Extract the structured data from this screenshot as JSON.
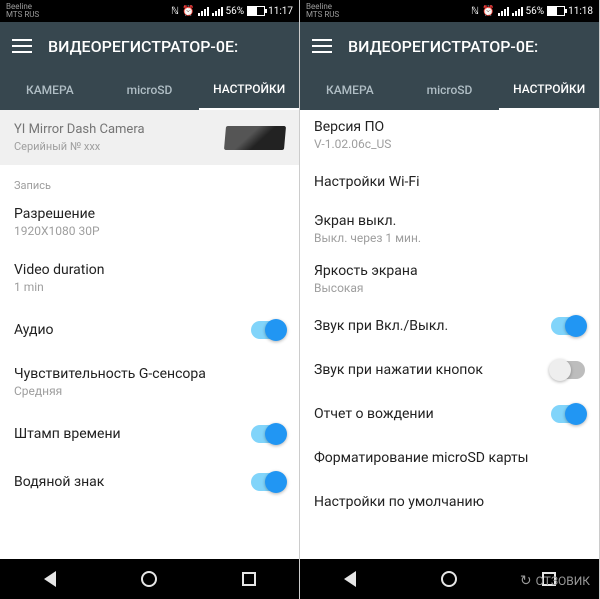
{
  "left": {
    "status": {
      "carrier1": "Beeline",
      "carrier2": "MTS RUS",
      "battery": "56%",
      "time": "11:17"
    },
    "header": {
      "title": "ВИДЕОРЕГИСТРАТОР-0E:"
    },
    "tabs": [
      {
        "label": "КАМЕРА",
        "active": false
      },
      {
        "label": "microSD",
        "active": false
      },
      {
        "label": "НАСТРОЙКИ",
        "active": true
      }
    ],
    "device": {
      "name": "YI Mirror Dash Camera",
      "serial": "Серийный № xxx"
    },
    "section": "Запись",
    "rows": [
      {
        "title": "Разрешение",
        "sub": "1920X1080 30P",
        "toggle": null
      },
      {
        "title": "Video duration",
        "sub": "1 min",
        "toggle": null
      },
      {
        "title": "Аудио",
        "sub": "",
        "toggle": true
      },
      {
        "title": "Чувствительность G-сенсора",
        "sub": "Средняя",
        "toggle": null
      },
      {
        "title": "Штамп времени",
        "sub": "",
        "toggle": true
      },
      {
        "title": "Водяной знак",
        "sub": "",
        "toggle": true
      }
    ]
  },
  "right": {
    "status": {
      "carrier1": "Beeline",
      "carrier2": "MTS RUS",
      "battery": "56%",
      "time": "11:18"
    },
    "header": {
      "title": "ВИДЕОРЕГИСТРАТОР-0E:"
    },
    "tabs": [
      {
        "label": "КАМЕРА",
        "active": false
      },
      {
        "label": "microSD",
        "active": false
      },
      {
        "label": "НАСТРОЙКИ",
        "active": true
      }
    ],
    "rows": [
      {
        "title": "Версия ПО",
        "sub": "V-1.02.06c_US",
        "toggle": null
      },
      {
        "title": "Настройки Wi-Fi",
        "sub": "",
        "toggle": null
      },
      {
        "title": "Экран выкл.",
        "sub": "Выкл. через 1 мин.",
        "toggle": null
      },
      {
        "title": "Яркость экрана",
        "sub": "Высокая",
        "toggle": null
      },
      {
        "title": "Звук при Вкл./Выкл.",
        "sub": "",
        "toggle": true
      },
      {
        "title": "Звук при нажатии кнопок",
        "sub": "",
        "toggle": false
      },
      {
        "title": "Отчет о вождении",
        "sub": "",
        "toggle": true
      },
      {
        "title": "Форматирование microSD карты",
        "sub": "",
        "toggle": null
      },
      {
        "title": "Настройки по умолчанию",
        "sub": "",
        "toggle": null
      }
    ]
  },
  "watermark": "ОТЗОВИК"
}
